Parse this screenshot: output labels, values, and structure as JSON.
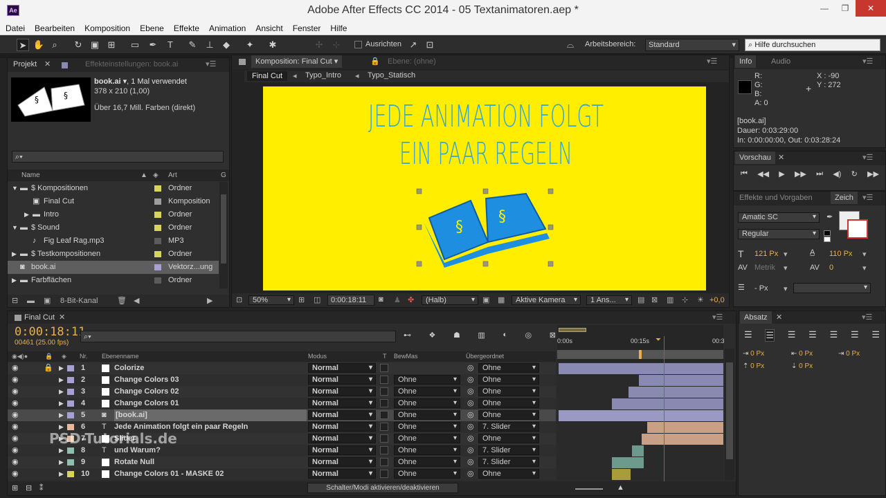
{
  "window": {
    "title": "Adobe After Effects CC 2014 - 05 Textanimatoren.aep *",
    "app_icon": "Ae"
  },
  "menu": [
    "Datei",
    "Bearbeiten",
    "Komposition",
    "Ebene",
    "Effekte",
    "Animation",
    "Ansicht",
    "Fenster",
    "Hilfe"
  ],
  "toolbar": {
    "align_label": "Ausrichten",
    "workspace_label": "Arbeitsbereich:",
    "workspace_value": "Standard",
    "help_placeholder": "Hilfe durchsuchen"
  },
  "project": {
    "tab_label": "Projekt",
    "effect_tab_label": "Effekteinstellungen: book.ai",
    "item_name": "book.ai",
    "item_usage": ", 1 Mal verwendet",
    "item_dims": "378 x 210 (1,00)",
    "item_colors": "Über 16,7 Mill. Farben (direkt)",
    "col_name": "Name",
    "col_type": "Art",
    "col_g": "G",
    "bit_depth": "8-Bit-Kanal",
    "rows": [
      {
        "indent": 0,
        "arrow": "▼",
        "icon": "folder",
        "name": "$ Kompositionen",
        "color": "yellow",
        "type": "Ordner"
      },
      {
        "indent": 1,
        "arrow": "",
        "icon": "comp",
        "name": "Final Cut",
        "color": "comp",
        "type": "Komposition"
      },
      {
        "indent": 1,
        "arrow": "▶",
        "icon": "folder",
        "name": "Intro",
        "color": "yellow",
        "type": "Ordner"
      },
      {
        "indent": 0,
        "arrow": "▼",
        "icon": "folder",
        "name": "$ Sound",
        "color": "yellow",
        "type": "Ordner"
      },
      {
        "indent": 1,
        "arrow": "",
        "icon": "audio",
        "name": "Fig Leaf Rag.mp3",
        "color": "gray",
        "type": "MP3"
      },
      {
        "indent": 0,
        "arrow": "▶",
        "icon": "folder",
        "name": "$ Testkompositionen",
        "color": "yellow",
        "type": "Ordner"
      },
      {
        "indent": 0,
        "arrow": "",
        "icon": "ai",
        "name": "book.ai",
        "color": "vio",
        "type": "Vektorz...ung",
        "selected": true
      },
      {
        "indent": 0,
        "arrow": "▶",
        "icon": "folder",
        "name": "Farbflächen",
        "color": "gray",
        "type": "Ordner"
      }
    ]
  },
  "comp_viewer": {
    "tab_label": "Komposition: Final Cut",
    "layer_tab": "Ebene: (ohne)",
    "breadcrumbs": [
      "Final Cut",
      "Typo_Intro",
      "Typo_Statisch"
    ],
    "headline_1": "JEDE ANIMATION FOLGT",
    "headline_2": "EIN PAAR REGELN",
    "zoom": "50%",
    "timecode": "0:00:18:11",
    "resolution": "(Halb)",
    "camera": "Aktive Kamera",
    "views": "1 Ans...",
    "exposure": "+0,0",
    "bg_color": "#ffee00",
    "text_color": "#3aa6c9",
    "book_color": "#1e8fe0"
  },
  "info": {
    "tab_label": "Info",
    "audio_tab": "Audio",
    "r": "R:",
    "g": "G:",
    "b": "B:",
    "a": "A:",
    "a_val": "0",
    "x": "X : -90",
    "y": "Y : 272",
    "name": "[book.ai]",
    "duration": "Dauer: 0:03:29:00",
    "inout": "In: 0:00:00:00, Out: 0:03:28:24"
  },
  "preview": {
    "tab_label": "Vorschau"
  },
  "effects": {
    "tab_label": "Effekte und Vorgaben",
    "char_tab": "Zeich"
  },
  "character": {
    "font": "Amatic SC",
    "style": "Regular",
    "size": "121 Px",
    "leading": "110 Px",
    "kerning": "Metrik",
    "tracking": "0",
    "stroke": "- Px"
  },
  "paragraph": {
    "tab_label": "Absatz",
    "v1": "0 Px",
    "v2": "0 Px",
    "v3": "0 Px",
    "v4": "0 Px",
    "v5": "0 Px"
  },
  "timeline": {
    "tab_label": "Final Cut",
    "timecode": "0:00:18:11",
    "frames": "00461 (25.00 fps)",
    "col_nr": "Nr.",
    "col_name": "Ebenenname",
    "col_mode": "Modus",
    "col_t": "T",
    "col_trk": "BewMas",
    "col_parent": "Übergeordnet",
    "ruler": [
      "0:00s",
      "00:15s",
      "00:3"
    ],
    "toggle_label": "Schalter/Modi aktivieren/deaktivieren",
    "watermark": "PSD-Tutorials.de",
    "layers": [
      {
        "nr": "1",
        "name": "Colorize",
        "color": "#a7a0d2",
        "type": "solid",
        "mode": "Normal",
        "trk": "",
        "parent": "Ohne",
        "bar_start": 0.01,
        "bar_color": "#8a89b2",
        "locked": true
      },
      {
        "nr": "2",
        "name": "Change Colors 03",
        "color": "#a7a0d2",
        "type": "solid",
        "mode": "Normal",
        "trk": "Ohne",
        "parent": "Ohne",
        "bar_start": 0.49,
        "bar_color": "#8a89b2"
      },
      {
        "nr": "3",
        "name": "Change Colors 02",
        "color": "#a7a0d2",
        "type": "solid",
        "mode": "Normal",
        "trk": "Ohne",
        "parent": "Ohne",
        "bar_start": 0.43,
        "bar_color": "#8a89b2"
      },
      {
        "nr": "4",
        "name": "Change Colors 01",
        "color": "#a7a0d2",
        "type": "solid",
        "mode": "Normal",
        "trk": "Ohne",
        "parent": "Ohne",
        "bar_start": 0.33,
        "bar_color": "#8a89b2"
      },
      {
        "nr": "5",
        "name": "[book.ai]",
        "color": "#a7a0d2",
        "type": "ai",
        "mode": "Normal",
        "trk": "Ohne",
        "parent": "Ohne",
        "bar_start": 0.01,
        "bar_color": "#9a99c4",
        "selected": true
      },
      {
        "nr": "6",
        "name": "Jede Animation folgt ein paar Regeln",
        "color": "#e7b89a",
        "type": "text",
        "mode": "Normal",
        "trk": "Ohne",
        "parent": "7. Slider",
        "bar_start": 0.54,
        "bar_color": "#c9a085"
      },
      {
        "nr": "7",
        "name": "Slider",
        "color": "#e7b89a",
        "type": "solid",
        "mode": "Normal",
        "trk": "Ohne",
        "parent": "Ohne",
        "bar_start": 0.51,
        "bar_color": "#c9a085"
      },
      {
        "nr": "8",
        "name": "und Warum?",
        "color": "#8fbfae",
        "type": "text",
        "mode": "Normal",
        "trk": "Ohne",
        "parent": "7. Slider",
        "bar_start": 0.45,
        "bar_color": "#6e9a8d",
        "bar_end": 0.52
      },
      {
        "nr": "9",
        "name": "Rotate Null",
        "color": "#8fbfae",
        "type": "solid",
        "mode": "Normal",
        "trk": "Ohne",
        "parent": "7. Slider",
        "bar_start": 0.33,
        "bar_color": "#6e9a8d",
        "bar_end": 0.52
      },
      {
        "nr": "10",
        "name": "Change Colors 01 - MASKE 02",
        "color": "#d8d35c",
        "type": "solid",
        "mode": "Normal",
        "trk": "Ohne",
        "parent": "Ohne",
        "bar_start": 0.33,
        "bar_color": "#a89d3a",
        "bar_end": 0.44
      }
    ]
  }
}
